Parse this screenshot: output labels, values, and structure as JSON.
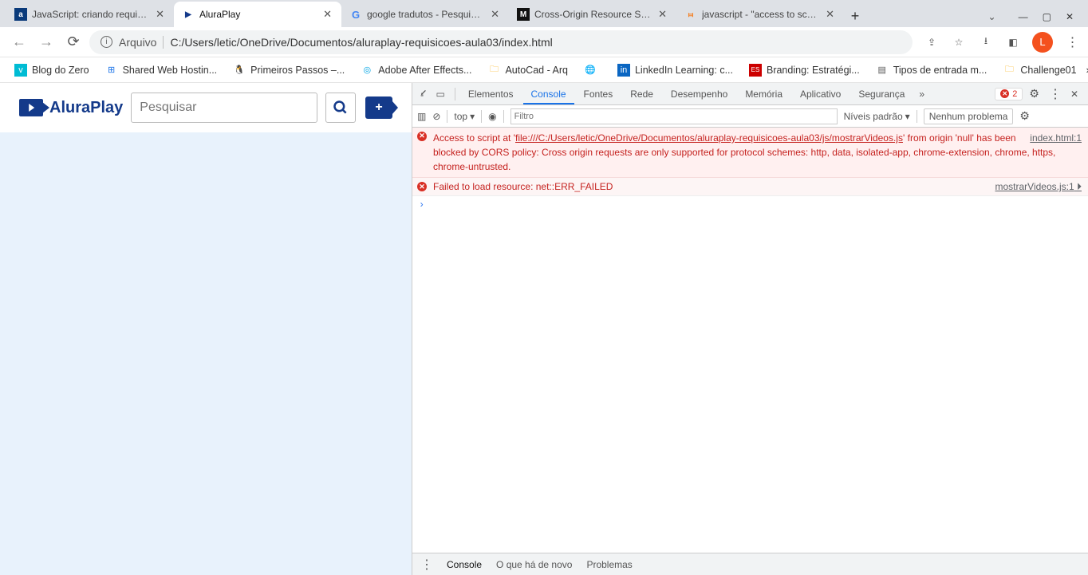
{
  "tabs": [
    {
      "title": "JavaScript: criando requisições"
    },
    {
      "title": "AluraPlay"
    },
    {
      "title": "google tradutos - Pesquisa G"
    },
    {
      "title": "Cross-Origin Resource Sharin"
    },
    {
      "title": "javascript - \"access to script"
    }
  ],
  "address": {
    "label": "Arquivo",
    "url": "C:/Users/letic/OneDrive/Documentos/aluraplay-requisicoes-aula03/index.html"
  },
  "profile_initial": "L",
  "bookmarks": [
    {
      "label": "Blog do Zero"
    },
    {
      "label": "Shared Web Hostin..."
    },
    {
      "label": "Primeiros Passos –..."
    },
    {
      "label": "Adobe After Effects..."
    },
    {
      "label": "AutoCad - Arq"
    },
    {
      "label": ""
    },
    {
      "label": "LinkedIn Learning: c..."
    },
    {
      "label": "Branding: Estratégi..."
    },
    {
      "label": "Tipos de entrada m..."
    },
    {
      "label": "Challenge01"
    }
  ],
  "page": {
    "logo": "AluraPlay",
    "search_placeholder": "Pesquisar",
    "add_label": "+"
  },
  "devtools": {
    "tabs": [
      "Elementos",
      "Console",
      "Fontes",
      "Rede",
      "Desempenho",
      "Memória",
      "Aplicativo",
      "Segurança"
    ],
    "error_count": "2",
    "toolbar": {
      "context": "top",
      "filter_placeholder": "Filtro",
      "levels": "Níveis padrão",
      "no_problems": "Nenhum problema"
    },
    "msg1": {
      "pre": "Access to script at '",
      "file": "file:///C:/Users/letic/OneDrive/Documentos/aluraplay-requisicoes-aula03/js/mostrarVideos.js",
      "post": "' from origin 'null' has been blocked by CORS policy: Cross origin requests are only supported for protocol schemes: http, data, isolated-app, chrome-extension, chrome, https, chrome-untrusted.",
      "source": "index.html:1"
    },
    "msg2": {
      "text": "Failed to load resource: net::ERR_FAILED",
      "source": "mostrarVideos.js:1"
    },
    "footer": [
      "Console",
      "O que há de novo",
      "Problemas"
    ]
  }
}
